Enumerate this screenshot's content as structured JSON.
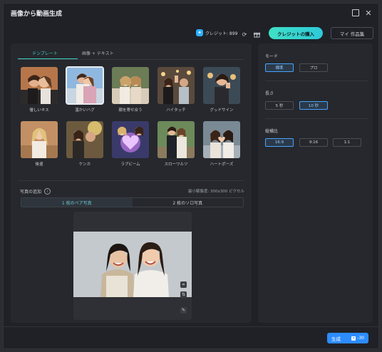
{
  "window": {
    "title": "画像から動画生成",
    "maximize_icon": "maximize-icon",
    "close_icon": "close-icon"
  },
  "topbar": {
    "credit_label": "クレジット: 899",
    "refresh_icon": "refresh-icon",
    "gift_icon": "gift-icon",
    "buy_label": "クレジットの購入",
    "works_label": "マイ 作品集"
  },
  "left": {
    "tabs": [
      "テンプレート",
      "画像 + テキスト"
    ],
    "templates": [
      {
        "label": "優しいキス"
      },
      {
        "label": "温かいハグ",
        "selected": true
      },
      {
        "label": "顔を寄せ合う"
      },
      {
        "label": "ハイタッチ"
      },
      {
        "label": "グッドサイン"
      },
      {
        "label": "後退"
      },
      {
        "label": "ケンカ"
      },
      {
        "label": "ラブビーム"
      },
      {
        "label": "スローワルツ"
      },
      {
        "label": "ハートポーズ"
      }
    ],
    "photo_add_label": "写真の追加",
    "min_resolution": "最小解像度: 300x300 ピクセル",
    "photo_modes": [
      "1 枚のペア写真",
      "2 枚のソロ写真"
    ],
    "active_mode": 0
  },
  "right": {
    "mode_label": "モード",
    "mode_options": [
      "標準",
      "プロ"
    ],
    "length_label": "長さ",
    "length_options": [
      "5 秒",
      "10 秒"
    ],
    "ratio_label": "縦横比",
    "ratio_options": [
      "16:9",
      "9:16",
      "1:1"
    ]
  },
  "footer": {
    "generate_label": "生成",
    "cost": "-30"
  },
  "colors": {
    "accent": "#3fd1c8",
    "primary": "#2d8cff",
    "bg": "#1f2126",
    "panel": "#26282d"
  }
}
